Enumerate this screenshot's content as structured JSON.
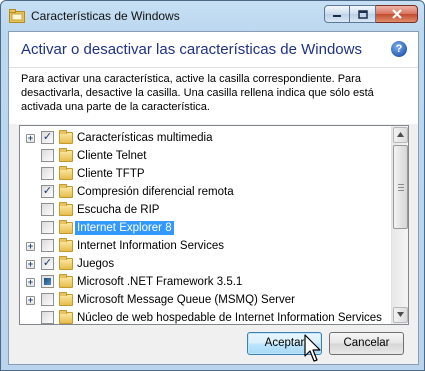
{
  "window": {
    "title": "Características de Windows",
    "buttons": {
      "minimize_icon": "minimize-icon",
      "maximize_icon": "maximize-icon",
      "close_icon": "close-icon"
    }
  },
  "header": {
    "heading": "Activar o desactivar las características de Windows",
    "help_glyph": "?"
  },
  "description": "Para activar una característica, active la casilla correspondiente. Para desactivarla, desactive la casilla. Una casilla rellena indica que sólo está activada una parte de la característica.",
  "features": [
    {
      "label": "Características multimedia",
      "expandable": true,
      "state": "checked",
      "selected": false
    },
    {
      "label": "Cliente Telnet",
      "expandable": false,
      "state": "unchecked",
      "selected": false
    },
    {
      "label": "Cliente TFTP",
      "expandable": false,
      "state": "unchecked",
      "selected": false
    },
    {
      "label": "Compresión diferencial remota",
      "expandable": false,
      "state": "checked",
      "selected": false
    },
    {
      "label": "Escucha de RIP",
      "expandable": false,
      "state": "unchecked",
      "selected": false
    },
    {
      "label": "Internet Explorer 8",
      "expandable": false,
      "state": "unchecked",
      "selected": true
    },
    {
      "label": "Internet Information Services",
      "expandable": true,
      "state": "unchecked",
      "selected": false
    },
    {
      "label": "Juegos",
      "expandable": true,
      "state": "checked",
      "selected": false
    },
    {
      "label": "Microsoft .NET Framework 3.5.1",
      "expandable": true,
      "state": "partial",
      "selected": false
    },
    {
      "label": "Microsoft Message Queue (MSMQ) Server",
      "expandable": true,
      "state": "unchecked",
      "selected": false
    },
    {
      "label": "Núcleo de web hospedable de Internet Information Services",
      "expandable": false,
      "state": "unchecked",
      "selected": false
    }
  ],
  "glyphs": {
    "expand": "+",
    "check": "✓"
  },
  "footer": {
    "ok_label": "Aceptar",
    "cancel_label": "Cancelar"
  }
}
